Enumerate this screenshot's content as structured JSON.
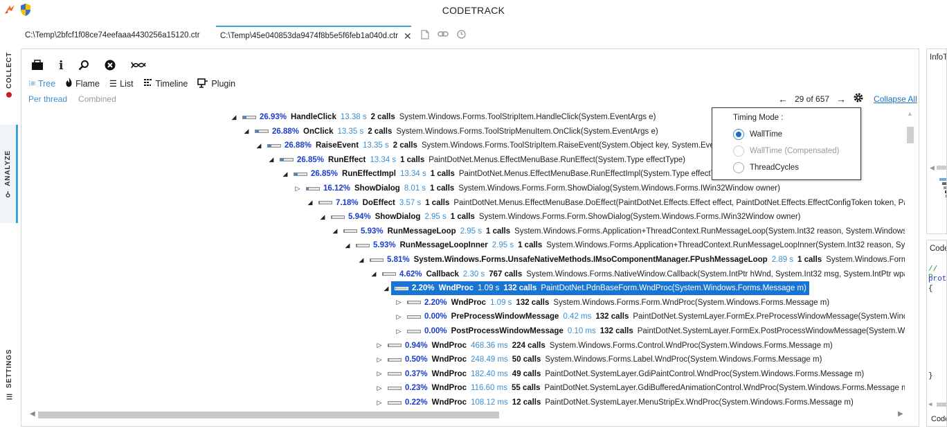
{
  "app": {
    "title": "CODETRACK"
  },
  "left_nav": {
    "collect": "COLLECT",
    "analyze": "ANALYZE",
    "settings": "SETTINGS"
  },
  "tabs": [
    {
      "label": "C:\\Temp\\2bfcf1f08ce74eefaaa4430256a15120.ctr"
    },
    {
      "label": "C:\\Temp\\45e040853da9474f8b5e5f6feb1a040d.ctr"
    }
  ],
  "views": {
    "tree": "Tree",
    "flame": "Flame",
    "list": "List",
    "timeline": "Timeline",
    "plugin": "Plugin"
  },
  "thread_modes": {
    "per_thread": "Per thread",
    "combined": "Combined"
  },
  "navigator": {
    "counter": "29 of 657",
    "collapse_all": "Collapse All"
  },
  "timing_mode": {
    "title": "Timing Mode :",
    "options": [
      {
        "label": "WallTime",
        "selected": true,
        "disabled": false
      },
      {
        "label": "WallTime (Compensated)",
        "selected": false,
        "disabled": true
      },
      {
        "label": "ThreadCycles",
        "selected": false,
        "disabled": false
      }
    ]
  },
  "tree_rows": [
    {
      "toggle": "expanded",
      "percent": "26.93%",
      "fill": 0.27,
      "name": "HandleClick",
      "time": "13.38 s",
      "calls": "2 calls",
      "signature": "System.Windows.Forms.ToolStripItem.HandleClick(System.EventArgs e)"
    },
    {
      "toggle": "expanded",
      "percent": "26.88%",
      "fill": 0.27,
      "name": "OnClick",
      "time": "13.35 s",
      "calls": "2 calls",
      "signature": "System.Windows.Forms.ToolStripMenuItem.OnClick(System.EventArgs e)"
    },
    {
      "toggle": "expanded",
      "percent": "26.88%",
      "fill": 0.27,
      "name": "RaiseEvent",
      "time": "13.35 s",
      "calls": "2 calls",
      "signature": "System.Windows.Forms.ToolStripItem.RaiseEvent(System.Object key, System.EventArgs e)"
    },
    {
      "toggle": "expanded",
      "percent": "26.85%",
      "fill": 0.27,
      "name": "RunEffect",
      "time": "13.34 s",
      "calls": "1 calls",
      "signature": "PaintDotNet.Menus.EffectMenuBase.RunEffect(System.Type effectType)"
    },
    {
      "toggle": "expanded",
      "percent": "26.85%",
      "fill": 0.27,
      "name": "RunEffectImpl",
      "time": "13.34 s",
      "calls": "1 calls",
      "signature": "PaintDotNet.Menus.EffectMenuBase.RunEffectImpl(System.Type effectType)"
    },
    {
      "toggle": "collapsed",
      "percent": "16.12%",
      "fill": 0.16,
      "name": "ShowDialog",
      "time": "8.01 s",
      "calls": "1 calls",
      "signature": "System.Windows.Forms.Form.ShowDialog(System.Windows.Forms.IWin32Window owner)"
    },
    {
      "toggle": "expanded",
      "percent": "7.18%",
      "fill": 0.07,
      "name": "DoEffect",
      "time": "3.57 s",
      "calls": "1 calls",
      "signature": "PaintDotNet.Menus.EffectMenuBase.DoEffect(PaintDotNet.Effects.Effect effect, PaintDotNet.Effects.EffectConfigToken token, PaintDotNet"
    },
    {
      "toggle": "expanded",
      "percent": "5.94%",
      "fill": 0.06,
      "name": "ShowDialog",
      "time": "2.95 s",
      "calls": "1 calls",
      "signature": "System.Windows.Forms.Form.ShowDialog(System.Windows.Forms.IWin32Window owner)"
    },
    {
      "toggle": "expanded",
      "percent": "5.93%",
      "fill": 0.06,
      "name": "RunMessageLoop",
      "time": "2.95 s",
      "calls": "1 calls",
      "signature": "System.Windows.Forms.Application+ThreadContext.RunMessageLoop(System.Int32 reason, System.Windows.Forms.Application"
    },
    {
      "toggle": "expanded",
      "percent": "5.93%",
      "fill": 0.06,
      "name": "RunMessageLoopInner",
      "time": "2.95 s",
      "calls": "1 calls",
      "signature": "System.Windows.Forms.Application+ThreadContext.RunMessageLoopInner(System.Int32 reason, System.Windows.Forms"
    },
    {
      "toggle": "expanded",
      "percent": "5.81%",
      "fill": 0.06,
      "name": "System.Windows.Forms.UnsafeNativeMethods.IMsoComponentManager.FPushMessageLoop",
      "time": "2.89 s",
      "calls": "1 calls",
      "signature": "System.Windows.Forms.Application"
    },
    {
      "toggle": "expanded",
      "percent": "4.62%",
      "fill": 0.05,
      "name": "Callback",
      "time": "2.30 s",
      "calls": "767 calls",
      "signature": "System.Windows.Forms.NativeWindow.Callback(System.IntPtr hWnd, System.Int32 msg, System.IntPtr wparam, System"
    },
    {
      "toggle": "expanded",
      "percent": "2.20%",
      "fill": 0.02,
      "name": "WndProc",
      "time": "1.09 s",
      "calls": "132 calls",
      "signature": "PaintDotNet.PdnBaseForm.WndProc(System.Windows.Forms.Message m)",
      "selected": true
    },
    {
      "toggle": "collapsed",
      "percent": "2.20%",
      "fill": 0.02,
      "name": "WndProc",
      "time": "1.09 s",
      "calls": "132 calls",
      "signature": "System.Windows.Forms.Form.WndProc(System.Windows.Forms.Message m)"
    },
    {
      "toggle": "collapsed",
      "percent": "0.00%",
      "fill": 0.0,
      "name": "PreProcessWindowMessage",
      "time": "0.42 ms",
      "calls": "132 calls",
      "signature": "PaintDotNet.SystemLayer.FormEx.PreProcessWindowMessage(System.Windows.Forms"
    },
    {
      "toggle": "collapsed",
      "percent": "0.00%",
      "fill": 0.0,
      "name": "PostProcessWindowMessage",
      "time": "0.10 ms",
      "calls": "132 calls",
      "signature": "PaintDotNet.SystemLayer.FormEx.PostProcessWindowMessage(System.Windows.Forms"
    },
    {
      "toggle": "collapsed",
      "percent": "0.94%",
      "fill": 0.01,
      "name": "WndProc",
      "time": "468.36 ms",
      "calls": "224 calls",
      "signature": "System.Windows.Forms.Control.WndProc(System.Windows.Forms.Message m)"
    },
    {
      "toggle": "collapsed",
      "percent": "0.50%",
      "fill": 0.005,
      "name": "WndProc",
      "time": "248.49 ms",
      "calls": "50 calls",
      "signature": "System.Windows.Forms.Label.WndProc(System.Windows.Forms.Message m)"
    },
    {
      "toggle": "collapsed",
      "percent": "0.37%",
      "fill": 0.004,
      "name": "WndProc",
      "time": "182.40 ms",
      "calls": "49 calls",
      "signature": "PaintDotNet.SystemLayer.GdiPaintControl.WndProc(System.Windows.Forms.Message m)"
    },
    {
      "toggle": "collapsed",
      "percent": "0.23%",
      "fill": 0.002,
      "name": "WndProc",
      "time": "116.60 ms",
      "calls": "55 calls",
      "signature": "PaintDotNet.SystemLayer.GdiBufferedAnimationControl.WndProc(System.Windows.Forms.Message m)"
    },
    {
      "toggle": "collapsed",
      "percent": "0.22%",
      "fill": 0.002,
      "name": "WndProc",
      "time": "108.12 ms",
      "calls": "12 calls",
      "signature": "PaintDotNet.SystemLayer.MenuStripEx.WndProc(System.Windows.Forms.Message m)"
    }
  ],
  "right_panel": {
    "info_title": "InfoT",
    "code_title": "Code",
    "code_lines": [
      "// P",
      "prot",
      "{",
      "}"
    ],
    "bottom_label": "Code"
  }
}
